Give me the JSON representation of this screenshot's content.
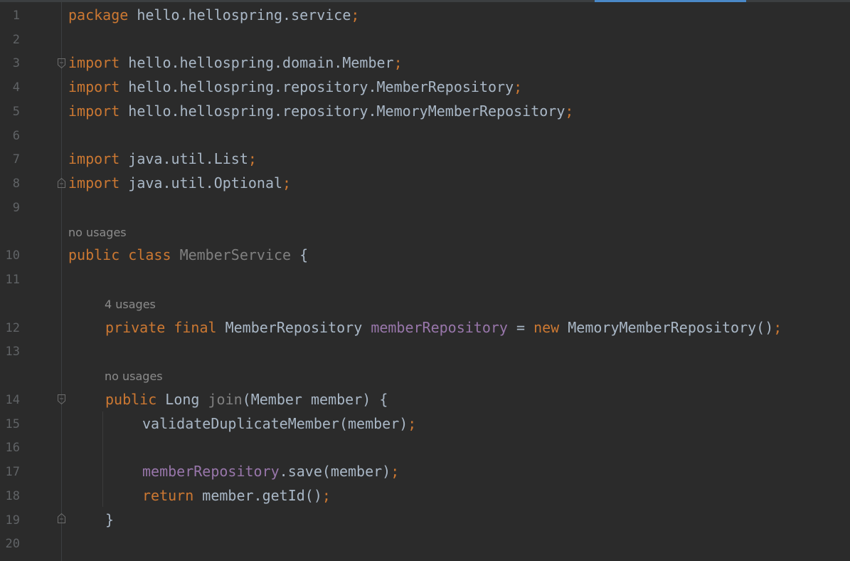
{
  "gutter": {
    "line_numbers": [
      "1",
      "2",
      "3",
      "4",
      "5",
      "6",
      "7",
      "8",
      "9",
      "10",
      "11",
      "12",
      "13",
      "14",
      "15",
      "16",
      "17",
      "18",
      "19",
      "20"
    ]
  },
  "hints": {
    "class_usages": "no usages",
    "field_usages": "4 usages",
    "method_usages": "no usages"
  },
  "code": {
    "l1": {
      "kw": "package",
      "rest": " hello.hellospring.service",
      "semi": ";"
    },
    "l3": {
      "kw": "import",
      "rest": " hello.hellospring.domain.Member",
      "semi": ";"
    },
    "l4": {
      "kw": "import",
      "rest": " hello.hellospring.repository.MemberRepository",
      "semi": ";"
    },
    "l5": {
      "kw": "import",
      "rest": " hello.hellospring.repository.MemoryMemberRepository",
      "semi": ";"
    },
    "l7": {
      "kw": "import",
      "rest": " java.util.List",
      "semi": ";"
    },
    "l8": {
      "kw": "import",
      "rest": " java.util.Optional",
      "semi": ";"
    },
    "l10": {
      "kw1": "public",
      "kw2": "class",
      "cls": "MemberService",
      "brace": " {"
    },
    "l12": {
      "kw1": "private",
      "kw2": "final",
      "type": " MemberRepository ",
      "field": "memberRepository",
      "eq": " = ",
      "kw3": "new",
      "rest": " MemoryMemberRepository()",
      "semi": ";"
    },
    "l14": {
      "kw1": "public",
      "type": " Long ",
      "method": "join",
      "rest": "(Member member) {"
    },
    "l15": {
      "rest": "validateDuplicateMember(member)",
      "semi": ";"
    },
    "l17": {
      "field": "memberRepository",
      "rest": ".save(member)",
      "semi": ";"
    },
    "l18": {
      "kw": "return",
      "rest": " member.getId()",
      "semi": ";"
    },
    "l19": {
      "rest": "}"
    }
  },
  "colors": {
    "background": "#2b2b2b",
    "keyword": "#cc7832",
    "identifier": "#a9b7c6",
    "field": "#9876aa",
    "unused": "#808080",
    "line_number": "#606366",
    "hint": "#8c8c8c",
    "active_tab_accent": "#4a88c7"
  }
}
